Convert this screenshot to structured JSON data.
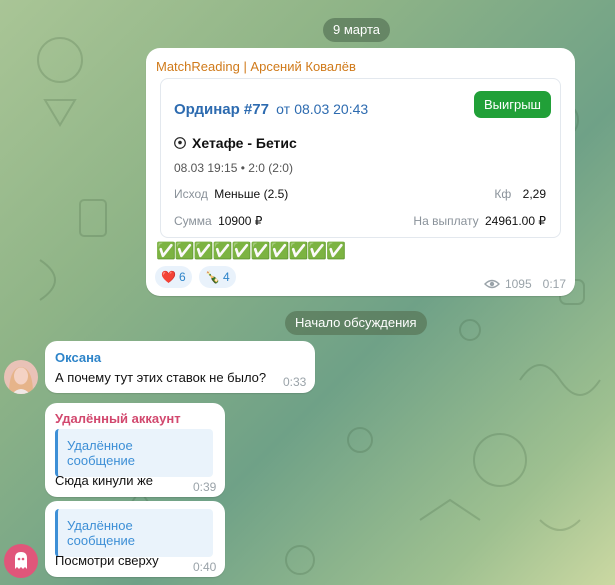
{
  "date_separator": "9 марта",
  "discussion_separator": "Начало обсуждения",
  "post": {
    "author": "MatchReading | Арсений Ковалёв",
    "bet": {
      "title": "Ординар #77",
      "date_prefix": "от",
      "date": "08.03 20:43",
      "status_label": "Выигрыш",
      "match": "Хетафе - Бетис",
      "match_info": "08.03 19:15 • 2:0 (2:0)",
      "outcome_label": "Исход",
      "outcome_value": "Меньше (2.5)",
      "odds_label": "Кф",
      "odds_value": "2,29",
      "stake_label": "Сумма",
      "stake_value": "10900 ₽",
      "payout_label": "На выплату",
      "payout_value": "24961.00 ₽"
    },
    "checkmarks": "✅✅✅✅✅✅✅✅✅✅",
    "reactions": [
      {
        "emoji": "❤️",
        "count": "6"
      },
      {
        "emoji": "🍾",
        "count": "4"
      }
    ],
    "views": "1095",
    "time": "0:17"
  },
  "messages": [
    {
      "author": "Оксана",
      "text": "А почему тут этих ставок не было?",
      "time": "0:33"
    },
    {
      "author": "Удалённый аккаунт",
      "reply": "Удалённое сообщение",
      "text": "Сюда кинули же",
      "time": "0:39"
    },
    {
      "reply": "Удалённое сообщение",
      "text": "Посмотри сверху",
      "time": "0:40"
    }
  ],
  "colors": {
    "win_green": "#21a038",
    "link_blue": "#2d84c9",
    "author_orange": "#d07a1a",
    "deleted_pink": "#d2486e"
  },
  "icons": {
    "eye": "eye-icon",
    "ghost": "ghost-avatar-icon",
    "soccer": "soccer-ball-icon"
  }
}
